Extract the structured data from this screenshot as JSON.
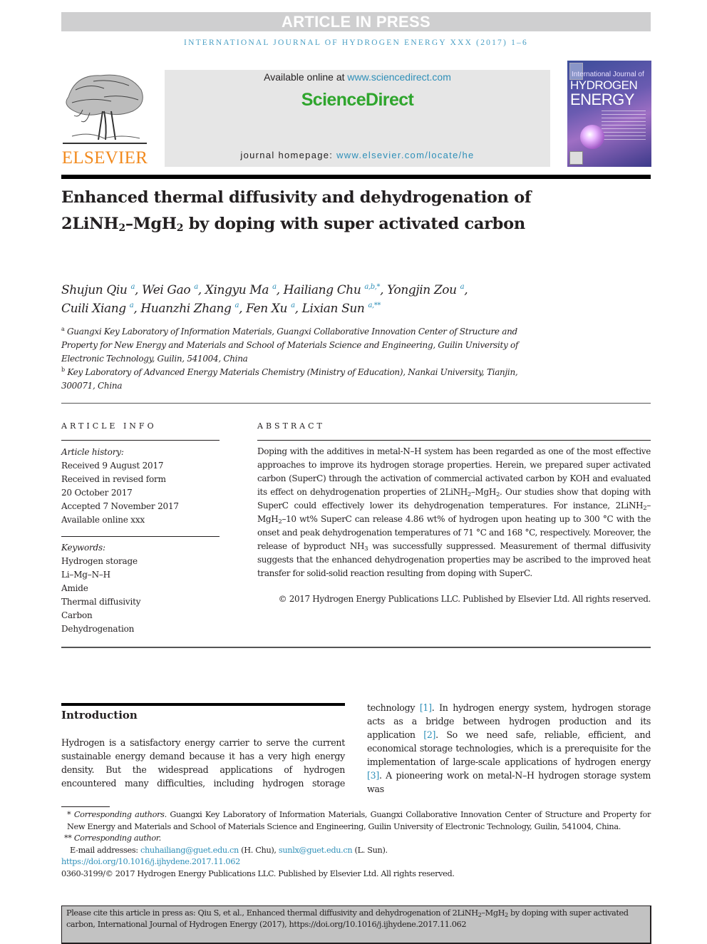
{
  "header": {
    "banner": "ARTICLE IN PRESS",
    "journal_line": "INTERNATIONAL JOURNAL OF HYDROGEN ENERGY XXX (2017) 1–6"
  },
  "masthead": {
    "publisher_logo_text": "ELSEVIER",
    "available_prefix": "Available online at ",
    "available_link": "www.sciencedirect.com",
    "brand": "ScienceDirect",
    "homepage_prefix": "journal homepage: ",
    "homepage_link": "www.elsevier.com/locate/he",
    "cover": {
      "line1": "International Journal of",
      "line2": "HYDROGEN",
      "line3": "ENERGY"
    }
  },
  "article": {
    "title_part1": "Enhanced thermal diffusivity and dehydrogenation of 2LiNH",
    "title_sub1": "2",
    "title_dash": "–MgH",
    "title_sub2": "2",
    "title_part2": " by doping with super activated carbon",
    "authors": [
      {
        "name": "Shujun Qiu",
        "aff": "a"
      },
      {
        "name": "Wei Gao",
        "aff": "a"
      },
      {
        "name": "Xingyu Ma",
        "aff": "a"
      },
      {
        "name": "Hailiang Chu",
        "aff": "a,b,*"
      },
      {
        "name": "Yongjin Zou",
        "aff": "a"
      },
      {
        "name": "Cuili Xiang",
        "aff": "a"
      },
      {
        "name": "Huanzhi Zhang",
        "aff": "a"
      },
      {
        "name": "Fen Xu",
        "aff": "a"
      },
      {
        "name": "Lixian Sun",
        "aff": "a,**"
      }
    ],
    "affiliations": [
      {
        "mark": "a",
        "text": "Guangxi Key Laboratory of Information Materials, Guangxi Collaborative Innovation Center of Structure and Property for New Energy and Materials and School of Materials Science and Engineering, Guilin University of Electronic Technology, Guilin, 541004, China"
      },
      {
        "mark": "b",
        "text": "Key Laboratory of Advanced Energy Materials Chemistry (Ministry of Education), Nankai University, Tianjin, 300071, China"
      }
    ]
  },
  "article_info": {
    "heading": "ARTICLE INFO",
    "history_label": "Article history:",
    "history": [
      "Received 9 August 2017",
      "Received in revised form",
      "20 October 2017",
      "Accepted 7 November 2017",
      "Available online xxx"
    ],
    "keywords_label": "Keywords:",
    "keywords": [
      "Hydrogen storage",
      "Li–Mg–N–H",
      "Amide",
      "Thermal diffusivity",
      "Carbon",
      "Dehydrogenation"
    ]
  },
  "abstract": {
    "heading": "ABSTRACT",
    "s1": "Doping with the additives in metal-N–H system has been regarded as one of the most effective approaches to improve its hydrogen storage properties. Herein, we prepared super activated carbon (SuperC) through the activation of commercial activated carbon by KOH and evaluated its effect on dehydrogenation properties of 2LiNH",
    "s2": "–MgH",
    "s3": ". Our studies show that doping with SuperC could effectively lower its dehydrogenation temperatures. For instance, 2LiNH",
    "s4": "–MgH",
    "s5": "–10 wt% SuperC can release 4.86 wt% of hydrogen upon heating up to 300 °C with the onset and peak dehydrogenation temperatures of 71 °C and 168 °C, respectively. Moreover, the release of byproduct NH",
    "s6": " was successfully suppressed. Measurement of thermal diffusivity suggests that the enhanced dehydrogenation properties may be ascribed to the improved heat transfer for solid-solid reaction resulting from doping with SuperC.",
    "sub2": "2",
    "sub3": "3",
    "copyright": "© 2017 Hydrogen Energy Publications LLC. Published by Elsevier Ltd. All rights reserved."
  },
  "introduction": {
    "heading": "Introduction",
    "p1": "Hydrogen is a satisfactory energy carrier to serve the current sustainable energy demand because it has a very high energy density. But the widespread applications of hydrogen encountered many difficulties, including hydrogen storage",
    "p2_a": "technology ",
    "ref1": "[1]",
    "p2_b": ". In hydrogen energy system, hydrogen storage acts as a bridge between hydrogen production and its application ",
    "ref2": "[2]",
    "p2_c": ". So we need safe, reliable, efficient, and economical storage technologies, which is a prerequisite for the implementation of large-scale applications of hydrogen energy ",
    "ref3": "[3]",
    "p2_d": ". A pioneering work on metal-N–H hydrogen storage system was"
  },
  "footnotes": {
    "corr1_mark": "* ",
    "corr1_label": "Corresponding authors",
    "corr1_text": ". Guangxi Key Laboratory of Information Materials, Guangxi Collaborative Innovation Center of Structure and Property for New Energy and Materials and School of Materials Science and Engineering, Guilin University of Electronic Technology, Guilin, 541004, China.",
    "corr2_mark": "** ",
    "corr2_label": "Corresponding author.",
    "email_label": "E-mail addresses: ",
    "email1": "chuhailiang@guet.edu.cn",
    "email1_name": " (H. Chu), ",
    "email2": "sunlx@guet.edu.cn",
    "email2_name": " (L. Sun).",
    "doi": "https://doi.org/10.1016/j.ijhydene.2017.11.062",
    "issn_line": "0360-3199/© 2017 Hydrogen Energy Publications LLC. Published by Elsevier Ltd. All rights reserved."
  },
  "citation": {
    "t1": "Please cite this article in press as: Qiu S, et al., Enhanced thermal diffusivity and dehydrogenation of 2LiNH",
    "t2": "–MgH",
    "t3": " by doping with super activated carbon, International Journal of Hydrogen Energy (2017), https://doi.org/10.1016/j.ijhydene.2017.11.062",
    "sub": "2"
  }
}
